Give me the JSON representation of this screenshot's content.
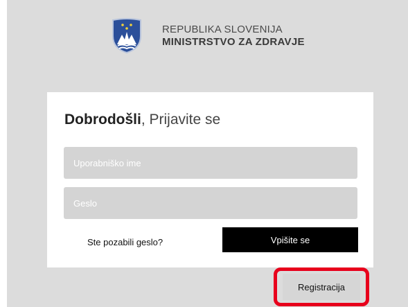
{
  "header": {
    "country": "REPUBLIKA SLOVENIJA",
    "ministry": "MINISTRSTVO ZA ZDRAVJE",
    "logo_icon": "slovenia-coat-of-arms-icon"
  },
  "login": {
    "welcome_bold": "Dobrodošli",
    "welcome_rest": ", Prijavite se",
    "username_placeholder": "Uporabniško ime",
    "password_placeholder": "Geslo",
    "forgot_label": "Ste pozabili geslo?",
    "login_label": "Vpišite se"
  },
  "register": {
    "label": "Registracija",
    "highlight_color": "#e8001c"
  }
}
